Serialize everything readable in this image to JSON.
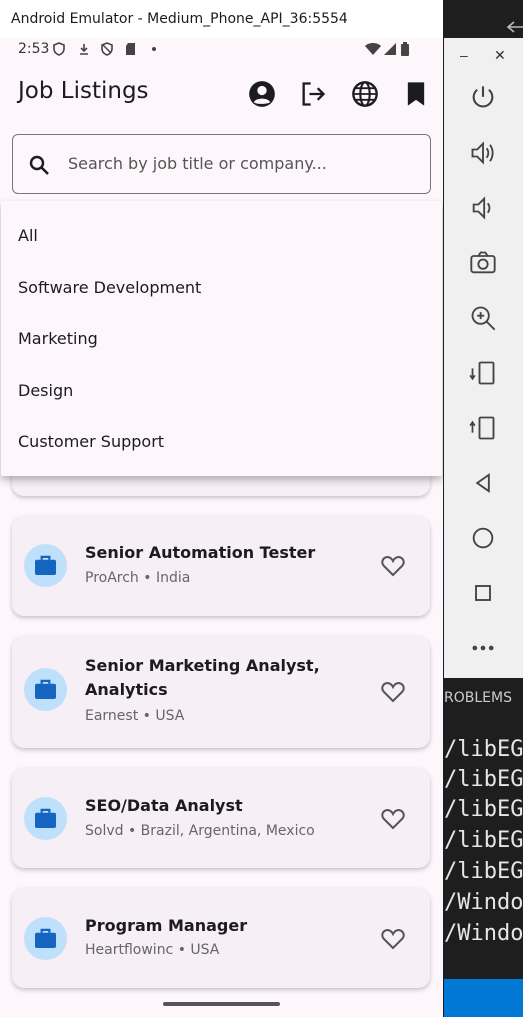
{
  "window": {
    "title": "Android Emulator - Medium_Phone_API_36:5554"
  },
  "status_bar": {
    "time": "2:53"
  },
  "app_bar": {
    "title": "Job Listings",
    "icons": [
      "account-circle-icon",
      "logout-icon",
      "globe-icon",
      "bookmark-icon"
    ]
  },
  "search": {
    "placeholder": "Search by job title or company..."
  },
  "category_dropdown": {
    "options": [
      "All",
      "Software Development",
      "Marketing",
      "Design",
      "Customer Support"
    ]
  },
  "jobs": [
    {
      "title": "Senior Automation Tester",
      "company_location": "ProArch • India"
    },
    {
      "title": "Senior Marketing Analyst, Analytics",
      "company_location": "Earnest • USA"
    },
    {
      "title": "SEO/Data Analyst",
      "company_location": "Solvd • Brazil, Argentina, Mexico"
    },
    {
      "title": "Program Manager",
      "company_location": "Heartflowinc • USA"
    }
  ],
  "emulator_toolbar": {
    "buttons": [
      "power-icon",
      "volume-up-icon",
      "volume-down-icon",
      "camera-icon",
      "zoom-in-icon",
      "rotate-left-icon",
      "rotate-right-icon",
      "back-icon",
      "home-icon",
      "overview-icon",
      "more-icon"
    ]
  },
  "vscode": {
    "panel_tab": "ROBLEMS",
    "lines": [
      "/libEGl",
      "/libEGl",
      "/libEGl",
      "/libEGl",
      "/libEGl",
      "/Window",
      "/Window"
    ]
  },
  "colors": {
    "accent": "#1565c0",
    "avatar_bg": "#bfe0fa",
    "surface": "#fdf7fc",
    "card": "#f6eff6",
    "vscode_status": "#0078d4"
  }
}
